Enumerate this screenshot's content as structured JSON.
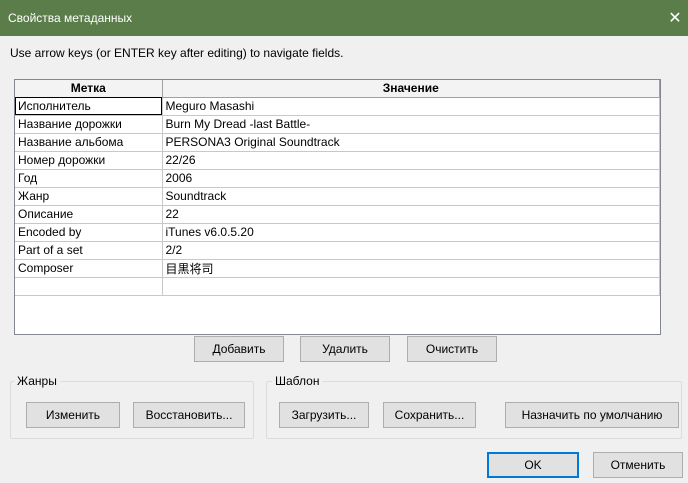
{
  "window": {
    "title": "Свойства метаданных",
    "close_glyph": "✕"
  },
  "hint": "Use arrow keys (or ENTER key after editing) to navigate fields.",
  "table": {
    "columns": [
      "Метка",
      "Значение"
    ],
    "rows": [
      {
        "label": "Исполнитель",
        "value": "Meguro Masashi"
      },
      {
        "label": "Название дорожки",
        "value": "Burn My Dread -last Battle-"
      },
      {
        "label": "Название альбома",
        "value": "PERSONA3 Original Soundtrack"
      },
      {
        "label": "Номер дорожки",
        "value": "22/26"
      },
      {
        "label": "Год",
        "value": "2006"
      },
      {
        "label": "Жанр",
        "value": "Soundtrack"
      },
      {
        "label": "Описание",
        "value": "22"
      },
      {
        "label": "Encoded by",
        "value": "iTunes v6.0.5.20"
      },
      {
        "label": "Part of a set",
        "value": "2/2"
      },
      {
        "label": "Composer",
        "value": "目黒将司"
      },
      {
        "label": "",
        "value": ""
      }
    ]
  },
  "row_buttons": {
    "add": "Добавить",
    "delete": "Удалить",
    "clear": "Очистить"
  },
  "genres": {
    "label": "Жанры",
    "edit": "Изменить",
    "restore": "Восстановить..."
  },
  "template": {
    "label": "Шаблон",
    "load": "Загрузить...",
    "save": "Сохранить...",
    "set_default": "Назначить по умолчанию"
  },
  "dialog_buttons": {
    "ok": "OK",
    "cancel": "Отменить"
  },
  "colors": {
    "titlebar": "#5a7d4a",
    "accent": "#0078d7"
  }
}
